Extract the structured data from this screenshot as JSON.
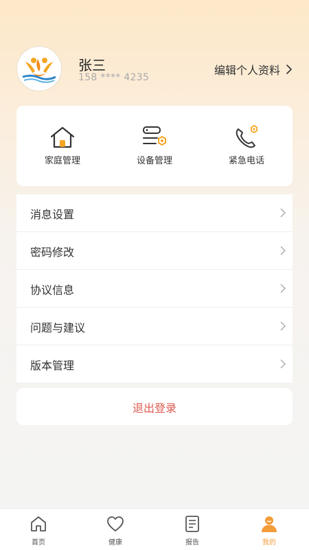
{
  "profile": {
    "name": "张三",
    "phone": "158 **** 4235",
    "edit_label": "编辑个人资料"
  },
  "quick_actions": [
    {
      "label": "家庭管理",
      "icon": "house-icon"
    },
    {
      "label": "设备管理",
      "icon": "device-settings-icon"
    },
    {
      "label": "紧急电话",
      "icon": "phone-icon"
    }
  ],
  "menu": [
    {
      "label": "消息设置"
    },
    {
      "label": "密码修改"
    },
    {
      "label": "协议信息"
    },
    {
      "label": "问题与建议"
    },
    {
      "label": "版本管理"
    }
  ],
  "logout_label": "退出登录",
  "tabs": [
    {
      "label": "首页",
      "icon": "home-icon"
    },
    {
      "label": "健康",
      "icon": "heart-icon"
    },
    {
      "label": "报告",
      "icon": "report-icon"
    },
    {
      "label": "我的",
      "icon": "user-icon",
      "active": true
    }
  ],
  "colors": {
    "accent": "#f39c3a",
    "danger": "#e05a4f",
    "header_gradient_top": "#fde8c8"
  }
}
